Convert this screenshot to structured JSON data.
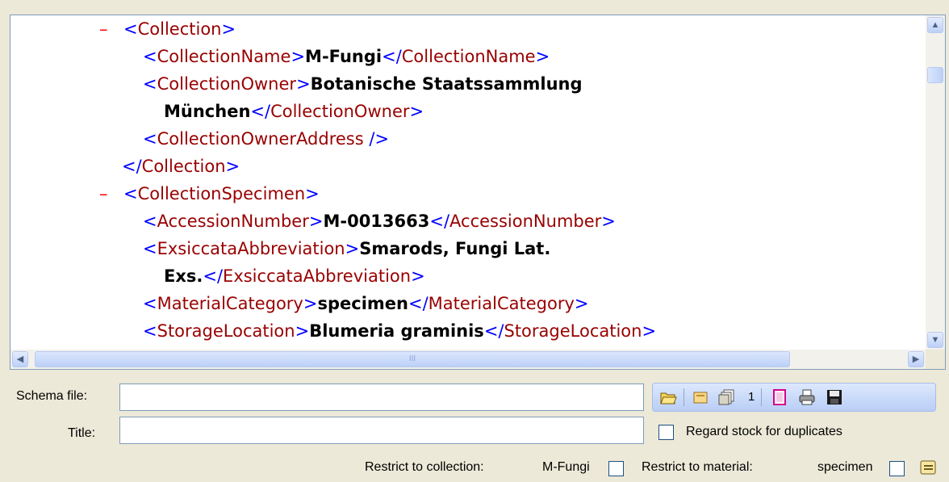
{
  "xml_view": {
    "lines": [
      {
        "type": "open",
        "minus": "–",
        "tag": "Collection"
      },
      {
        "type": "elem",
        "tag": "CollectionName",
        "value": "M-Fungi"
      },
      {
        "type": "elem_wrap",
        "tag": "CollectionOwner",
        "value1": "Botanische Staatssammlung",
        "value2": "München"
      },
      {
        "type": "empty",
        "tag": "CollectionOwnerAddress"
      },
      {
        "type": "close",
        "tag": "Collection"
      },
      {
        "type": "open",
        "minus": "–",
        "tag": "CollectionSpecimen"
      },
      {
        "type": "elem",
        "tag": "AccessionNumber",
        "value": "M-0013663"
      },
      {
        "type": "elem_wrap",
        "tag": "ExsiccataAbbreviation",
        "value1": "Smarods, Fungi Lat.",
        "value2": "Exs."
      },
      {
        "type": "elem",
        "tag": "MaterialCategory",
        "value": "specimen"
      },
      {
        "type": "elem",
        "tag": "StorageLocation",
        "value": "Blumeria graminis"
      }
    ]
  },
  "scrollbars": {
    "up_arrow": "▲",
    "down_arrow": "▼",
    "left_arrow": "◀",
    "right_arrow": "▶",
    "grip": "III"
  },
  "form": {
    "schema_label": "Schema file:",
    "schema_value": "",
    "title_label": "Title:",
    "title_value": "",
    "regard_stock_label": "Regard stock for duplicates",
    "restrict_collection_label": "Restrict to collection:",
    "restrict_collection_value": "M-Fungi",
    "restrict_material_label": "Restrict to material:",
    "restrict_material_value": "specimen"
  },
  "toolbar": {
    "page_number": "1",
    "icons": [
      "open-folder-icon",
      "folder-icon",
      "copy-pages-icon",
      "new-document-icon",
      "printer-icon",
      "save-disk-icon"
    ]
  },
  "colors": {
    "tag_name": "#990000",
    "bracket": "#0000ff",
    "minus": "#ff0000",
    "value": "#000000"
  }
}
